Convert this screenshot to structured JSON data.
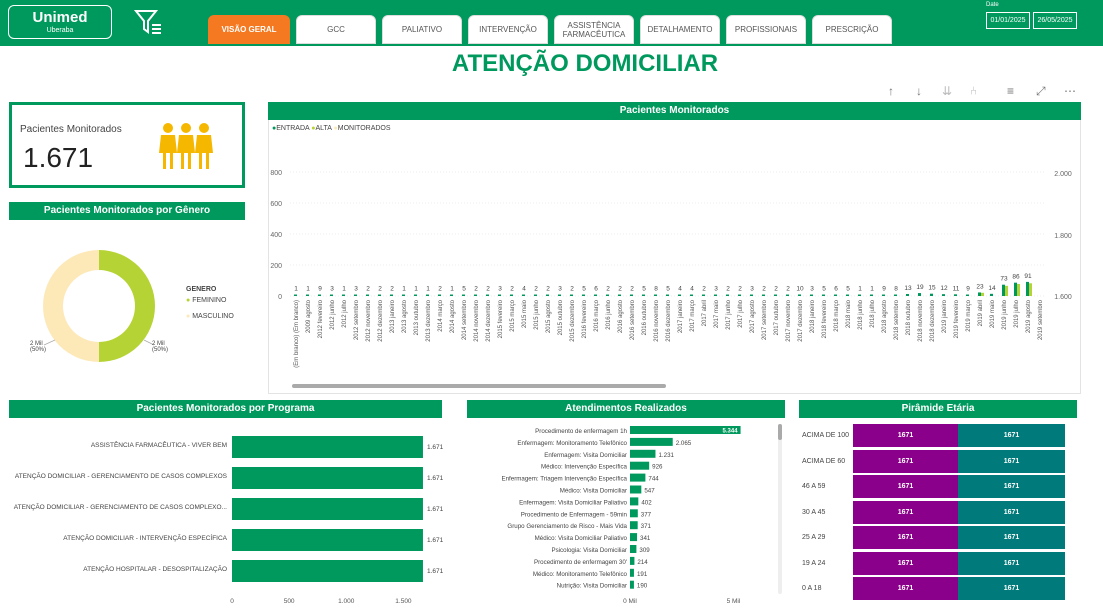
{
  "brand": {
    "name": "Unimed",
    "city": "Uberaba"
  },
  "tabs": [
    "VISÃO GERAL",
    "GCC",
    "PALIATIVO",
    "INTERVENÇÃO",
    "ASSISTÊNCIA FARMACÊUTICA",
    "DETALHAMENTO",
    "PROFISSIONAIS",
    "PRESCRIÇÃO"
  ],
  "active_tab": "VISÃO GERAL",
  "date": {
    "label": "Date",
    "start": "01/01/2025",
    "end": "26/05/2025"
  },
  "title": "ATENÇÃO DOMICILIAR",
  "kpi": {
    "label": "Pacientes Monitorados",
    "value": "1.671"
  },
  "colors": {
    "green": "#00995D",
    "lightgreen": "#B5D334",
    "cream": "#FDE9B8",
    "orange": "#F47920",
    "purple": "#8B008B",
    "teal": "#007A7A"
  },
  "genero": {
    "title": "Pacientes Monitorados por Gênero",
    "legend_title": "GENERO",
    "items": [
      {
        "name": "FEMININO",
        "value": "2 Mil",
        "pct": "(50%)"
      },
      {
        "name": "MASCULINO",
        "value": "2 Mil",
        "pct": "(50%)"
      }
    ]
  },
  "chart_data": [
    {
      "type": "bar",
      "title": "Pacientes Monitorados",
      "legend": [
        "ENTRADA",
        "ALTA",
        "MONITORADOS"
      ],
      "yticks_left": [
        "0",
        "200",
        "400",
        "600",
        "800"
      ],
      "yticks_right": [
        "1.600",
        "1.800",
        "2.000"
      ],
      "categories": [
        "(Em branco) (Em branco)",
        "2009 agosto",
        "2012 fevereiro",
        "2012 junho",
        "2012 julho",
        "2012 setembro",
        "2012 novembro",
        "2012 dezembro",
        "2013 janeiro",
        "2013 agosto",
        "2013 outubro",
        "2013 dezembro",
        "2014 março",
        "2014 agosto",
        "2014 setembro",
        "2014 novembro",
        "2014 dezembro",
        "2015 fevereiro",
        "2015 março",
        "2015 maio",
        "2015 junho",
        "2015 agosto",
        "2015 outubro",
        "2015 dezembro",
        "2016 fevereiro",
        "2016 março",
        "2016 junho",
        "2016 agosto",
        "2016 setembro",
        "2016 outubro",
        "2016 novembro",
        "2016 dezembro",
        "2017 janeiro",
        "2017 março",
        "2017 abril",
        "2017 maio",
        "2017 junho",
        "2017 julho",
        "2017 agosto",
        "2017 setembro",
        "2017 outubro",
        "2017 novembro",
        "2017 dezembro",
        "2018 janeiro",
        "2018 fevereiro",
        "2018 março",
        "2018 maio",
        "2018 junho",
        "2018 julho",
        "2018 agosto",
        "2018 setembro",
        "2018 outubro",
        "2018 novembro",
        "2018 dezembro",
        "2019 janeiro",
        "2019 fevereiro",
        "2019 março",
        "2019 abril",
        "2019 maio",
        "2019 junho",
        "2019 julho",
        "2019 agosto",
        "2019 setembro"
      ],
      "values": [
        1,
        1,
        9,
        3,
        1,
        3,
        2,
        2,
        2,
        1,
        1,
        1,
        2,
        1,
        5,
        2,
        2,
        3,
        2,
        4,
        2,
        2,
        3,
        2,
        5,
        6,
        2,
        2,
        2,
        5,
        8,
        5,
        4,
        4,
        2,
        3,
        2,
        2,
        3,
        2,
        2,
        2,
        10,
        3,
        5,
        6,
        5,
        1,
        1,
        9,
        8,
        13,
        19,
        15,
        12,
        11,
        9,
        23,
        14,
        73,
        86,
        91,
        null
      ]
    },
    {
      "type": "bar",
      "title": "Pacientes Monitorados por Programa",
      "orientation": "horizontal",
      "categories": [
        "ASSISTÊNCIA FARMACÊUTICA - VIVER BEM",
        "ATENÇÃO DOMICILIAR - GERENCIAMENTO DE CASOS COMPLEXOS",
        "ATENÇÃO DOMICILIAR - GERENCIAMENTO DE CASOS COMPLEXO...",
        "ATENÇÃO DOMICILIAR - INTERVENÇÃO ESPECÍFICA",
        "ATENÇÃO HOSPITALAR - DESOSPITALIZAÇÃO"
      ],
      "values": [
        1671,
        1671,
        1671,
        1671,
        1671
      ],
      "value_labels": [
        "1.671",
        "1.671",
        "1.671",
        "1.671",
        "1.671"
      ],
      "xticks": [
        "0",
        "500",
        "1.000",
        "1.500"
      ],
      "xlim": [
        0,
        1750
      ]
    },
    {
      "type": "bar",
      "title": "Atendimentos Realizados",
      "orientation": "horizontal",
      "categories": [
        "Procedimento de enfermagem 1h",
        "Enfermagem: Monitoramento Telefônico",
        "Enfermagem: Visita Domiciliar",
        "Médico: Intervenção Específica",
        "Enfermagem: Triagem Intervenção Específica",
        "Médico: Visita Domiciliar",
        "Enfermagem: Visita Domiciliar Paliativo",
        "Procedimento de Enfermagem - 59min",
        "Grupo Gerenciamento de Risco - Mais Vida",
        "Médico: Visita Domiciliar Paliativo",
        "Psicologia: Visita Domiciliar",
        "Procedimento de enfermagem 30'",
        "Médico: Monitoramento Telefônico",
        "Nutrição: Visita Domiciliar"
      ],
      "values": [
        5344,
        2065,
        1231,
        926,
        744,
        547,
        402,
        377,
        371,
        341,
        309,
        214,
        191,
        190
      ],
      "value_labels": [
        "5.344",
        "2.065",
        "1.231",
        "926",
        "744",
        "547",
        "402",
        "377",
        "371",
        "341",
        "309",
        "214",
        "191",
        "190"
      ],
      "xticks": [
        "0 Mil",
        "5 Mil"
      ],
      "xlim": [
        0,
        5800
      ]
    },
    {
      "type": "table",
      "title": "Pirâmide Etária",
      "rows": [
        {
          "label": "ACIMA DE 100",
          "a": "1671",
          "b": "1671"
        },
        {
          "label": "ACIMA DE 60",
          "a": "1671",
          "b": "1671"
        },
        {
          "label": "46 A 59",
          "a": "1671",
          "b": "1671"
        },
        {
          "label": "30 A 45",
          "a": "1671",
          "b": "1671"
        },
        {
          "label": "25 A 29",
          "a": "1671",
          "b": "1671"
        },
        {
          "label": "19 A 24",
          "a": "1671",
          "b": "1671"
        },
        {
          "label": "0 A 18",
          "a": "1671",
          "b": "1671"
        }
      ]
    }
  ]
}
